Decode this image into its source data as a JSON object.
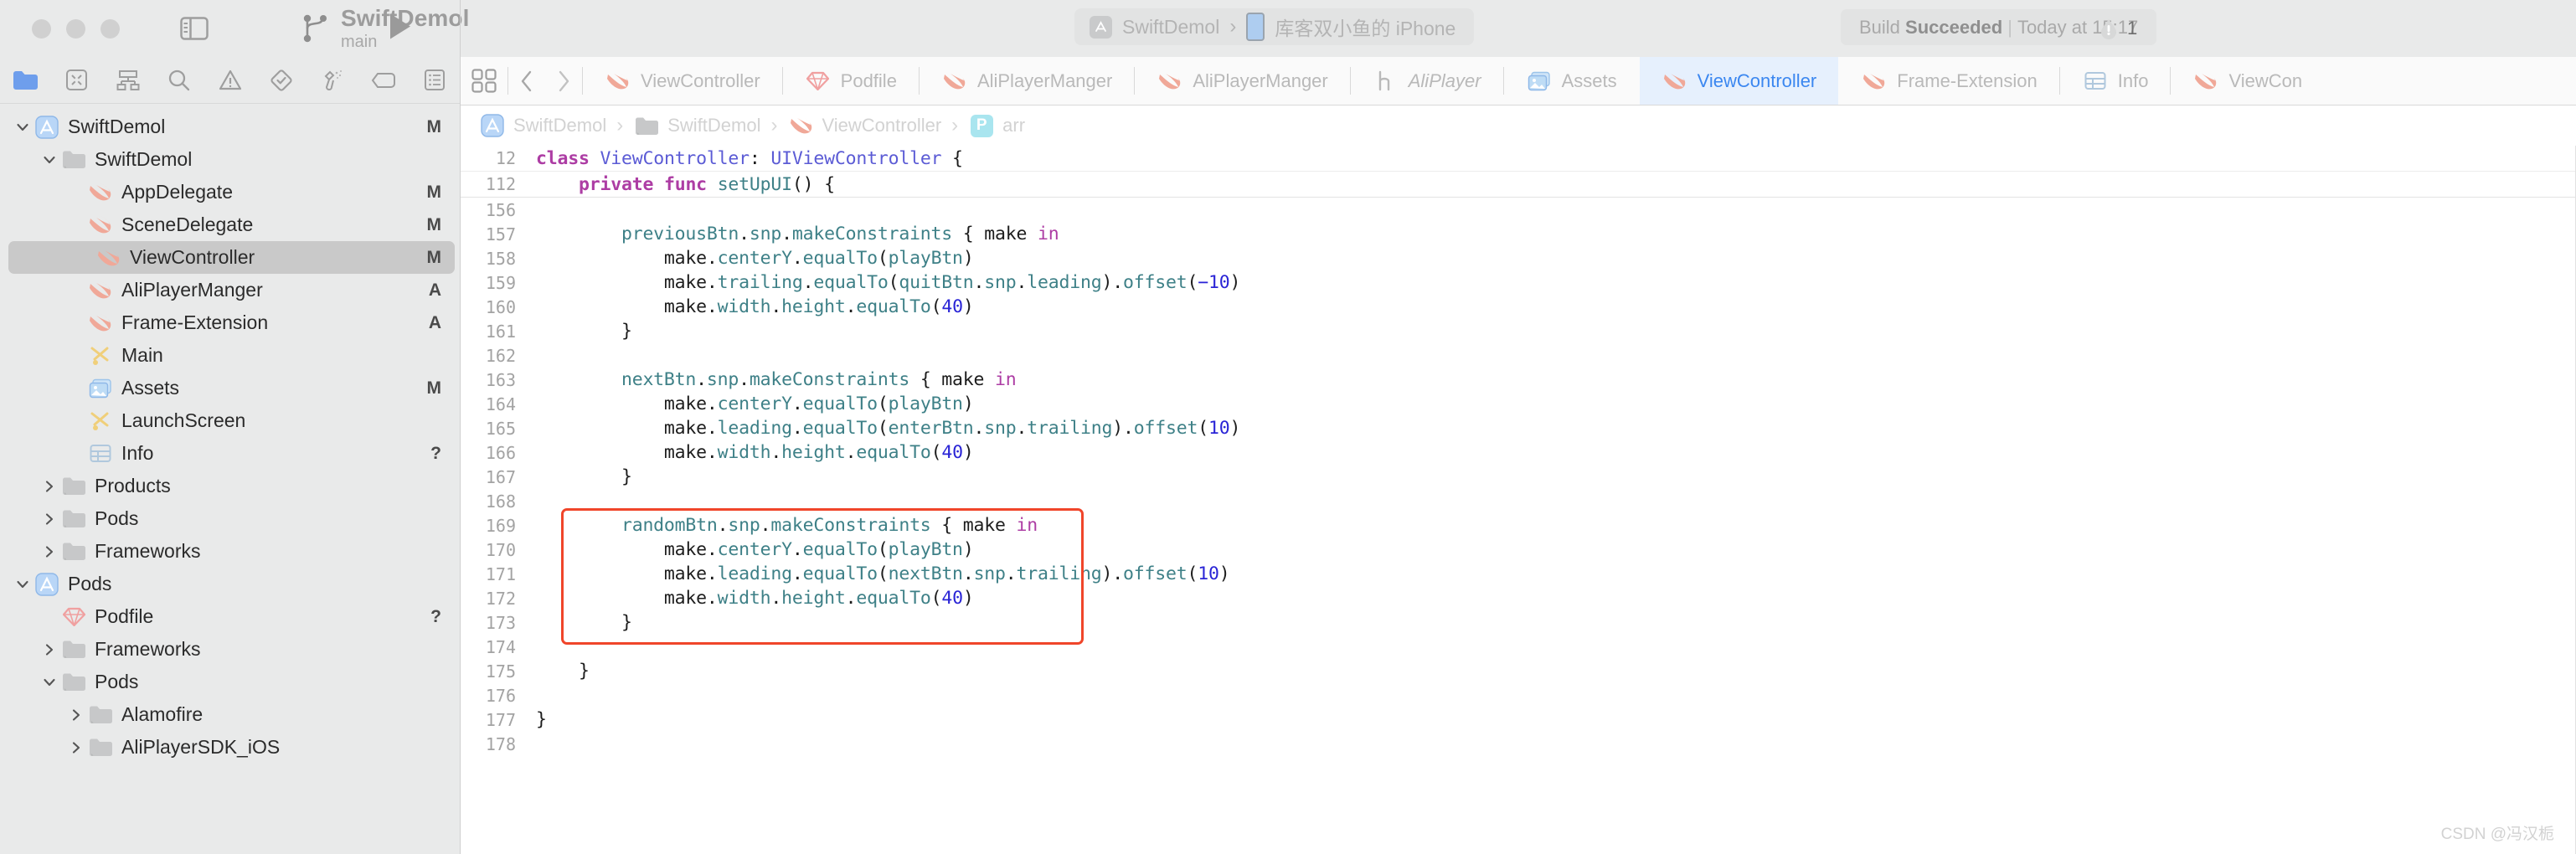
{
  "toolbar": {
    "window_buttons": [
      "close",
      "minimize",
      "zoom"
    ],
    "sidebar_toggle": "toggle-navigator",
    "run_button": "run",
    "project_name": "SwiftDemol",
    "branch_name": "main",
    "scheme_name": "SwiftDemol",
    "scheme_separator": "›",
    "device_name": "库客双小鱼的 iPhone",
    "status_prefix": "Build ",
    "status_result": "Succeeded",
    "status_divider": "|",
    "status_time": "Today at 15:17",
    "warning_count": "1"
  },
  "navigator": {
    "icons": [
      "folder-icon",
      "source-control-icon",
      "hierarchy-icon",
      "search-icon",
      "warning-icon",
      "test-icon",
      "debug-icon",
      "breakpoint-icon",
      "report-icon"
    ],
    "tree": [
      {
        "label": "SwiftDemol",
        "indent": 0,
        "icon": "app-project-icon",
        "twisty": "down",
        "badge": "M",
        "selected": false
      },
      {
        "label": "SwiftDemol",
        "indent": 1,
        "icon": "folder-icon",
        "twisty": "down",
        "badge": "",
        "selected": false
      },
      {
        "label": "AppDelegate",
        "indent": 2,
        "icon": "swift-icon",
        "twisty": "",
        "badge": "M",
        "selected": false
      },
      {
        "label": "SceneDelegate",
        "indent": 2,
        "icon": "swift-icon",
        "twisty": "",
        "badge": "M",
        "selected": false
      },
      {
        "label": "ViewController",
        "indent": 2,
        "icon": "swift-icon",
        "twisty": "",
        "badge": "M",
        "selected": true
      },
      {
        "label": "AliPlayerManger",
        "indent": 2,
        "icon": "swift-icon",
        "twisty": "",
        "badge": "A",
        "selected": false
      },
      {
        "label": "Frame-Extension",
        "indent": 2,
        "icon": "swift-icon",
        "twisty": "",
        "badge": "A",
        "selected": false
      },
      {
        "label": "Main",
        "indent": 2,
        "icon": "storyboard-icon",
        "twisty": "",
        "badge": "",
        "selected": false
      },
      {
        "label": "Assets",
        "indent": 2,
        "icon": "assets-icon",
        "twisty": "",
        "badge": "M",
        "selected": false
      },
      {
        "label": "LaunchScreen",
        "indent": 2,
        "icon": "storyboard-icon",
        "twisty": "",
        "badge": "",
        "selected": false
      },
      {
        "label": "Info",
        "indent": 2,
        "icon": "plist-icon",
        "twisty": "",
        "badge": "?",
        "selected": false
      },
      {
        "label": "Products",
        "indent": 1,
        "icon": "folder-icon",
        "twisty": "right",
        "badge": "",
        "selected": false
      },
      {
        "label": "Pods",
        "indent": 1,
        "icon": "folder-icon",
        "twisty": "right",
        "badge": "",
        "selected": false
      },
      {
        "label": "Frameworks",
        "indent": 1,
        "icon": "folder-icon",
        "twisty": "right",
        "badge": "",
        "selected": false
      },
      {
        "label": "Pods",
        "indent": 0,
        "icon": "app-project-icon",
        "twisty": "down",
        "badge": "",
        "selected": false
      },
      {
        "label": "Podfile",
        "indent": 1,
        "icon": "ruby-icon",
        "twisty": "",
        "badge": "?",
        "selected": false
      },
      {
        "label": "Frameworks",
        "indent": 1,
        "icon": "folder-icon",
        "twisty": "right",
        "badge": "",
        "selected": false
      },
      {
        "label": "Pods",
        "indent": 1,
        "icon": "folder-icon",
        "twisty": "down",
        "badge": "",
        "selected": false
      },
      {
        "label": "Alamofire",
        "indent": 2,
        "icon": "folder-icon",
        "twisty": "right",
        "badge": "",
        "selected": false
      },
      {
        "label": "AliPlayerSDK_iOS",
        "indent": 2,
        "icon": "folder-icon",
        "twisty": "right",
        "badge": "",
        "selected": false
      }
    ]
  },
  "editor": {
    "toolbar_icons": [
      "editor-layout-icon",
      "back-arrow-icon",
      "forward-arrow-icon"
    ],
    "tabs": [
      {
        "label": "ViewController",
        "icon": "swift-icon",
        "active": false,
        "italic": false
      },
      {
        "label": "Podfile",
        "icon": "ruby-icon",
        "active": false,
        "italic": false
      },
      {
        "label": "AliPlayerManger",
        "icon": "swift-icon",
        "active": false,
        "italic": false
      },
      {
        "label": "AliPlayerManger",
        "icon": "swift-icon",
        "active": false,
        "italic": false
      },
      {
        "label": "AliPlayer",
        "icon": "header-icon",
        "active": false,
        "italic": true
      },
      {
        "label": "Assets",
        "icon": "assets-icon",
        "active": false,
        "italic": false
      },
      {
        "label": "ViewController",
        "icon": "swift-icon",
        "active": true,
        "italic": false
      },
      {
        "label": "Frame-Extension",
        "icon": "swift-icon",
        "active": false,
        "italic": false
      },
      {
        "label": "Info",
        "icon": "plist-icon",
        "active": false,
        "italic": false
      },
      {
        "label": "ViewCon",
        "icon": "swift-icon",
        "active": false,
        "italic": false
      }
    ],
    "breadcrumb": [
      {
        "label": "SwiftDemol",
        "icon": "app-project-icon"
      },
      {
        "label": "SwiftDemol",
        "icon": "folder-icon"
      },
      {
        "label": "ViewController",
        "icon": "swift-icon"
      },
      {
        "label": "arr",
        "icon": "property-badge",
        "badge_letter": "P"
      }
    ],
    "breadcrumb_separator": "›",
    "pinned_lines": [
      {
        "num": "12",
        "tokens": [
          {
            "t": "class",
            "c": "kw"
          },
          {
            "t": " ",
            "c": "plain"
          },
          {
            "t": "ViewController",
            "c": "type"
          },
          {
            "t": ": ",
            "c": "plain"
          },
          {
            "t": "UIViewController",
            "c": "type"
          },
          {
            "t": " {",
            "c": "plain"
          }
        ]
      },
      {
        "num": "112",
        "tokens": [
          {
            "t": "    ",
            "c": "plain"
          },
          {
            "t": "private",
            "c": "kw"
          },
          {
            "t": " ",
            "c": "plain"
          },
          {
            "t": "func",
            "c": "kw"
          },
          {
            "t": " ",
            "c": "plain"
          },
          {
            "t": "setUpUI",
            "c": "mth"
          },
          {
            "t": "() {",
            "c": "plain"
          }
        ]
      }
    ],
    "lines": [
      {
        "num": "156",
        "tokens": []
      },
      {
        "num": "157",
        "tokens": [
          {
            "t": "        ",
            "c": "plain"
          },
          {
            "t": "previousBtn",
            "c": "typec"
          },
          {
            "t": ".",
            "c": "plain"
          },
          {
            "t": "snp",
            "c": "typec"
          },
          {
            "t": ".",
            "c": "plain"
          },
          {
            "t": "makeConstraints",
            "c": "typec"
          },
          {
            "t": " { make ",
            "c": "plain"
          },
          {
            "t": "in",
            "c": "kw2"
          }
        ]
      },
      {
        "num": "158",
        "tokens": [
          {
            "t": "            make.",
            "c": "plain"
          },
          {
            "t": "centerY",
            "c": "typec"
          },
          {
            "t": ".",
            "c": "plain"
          },
          {
            "t": "equalTo",
            "c": "typec"
          },
          {
            "t": "(",
            "c": "plain"
          },
          {
            "t": "playBtn",
            "c": "typec"
          },
          {
            "t": ")",
            "c": "plain"
          }
        ]
      },
      {
        "num": "159",
        "tokens": [
          {
            "t": "            make.",
            "c": "plain"
          },
          {
            "t": "trailing",
            "c": "typec"
          },
          {
            "t": ".",
            "c": "plain"
          },
          {
            "t": "equalTo",
            "c": "typec"
          },
          {
            "t": "(",
            "c": "plain"
          },
          {
            "t": "quitBtn",
            "c": "typec"
          },
          {
            "t": ".",
            "c": "plain"
          },
          {
            "t": "snp",
            "c": "typec"
          },
          {
            "t": ".",
            "c": "plain"
          },
          {
            "t": "leading",
            "c": "typec"
          },
          {
            "t": ").",
            "c": "plain"
          },
          {
            "t": "offset",
            "c": "typec"
          },
          {
            "t": "(",
            "c": "plain"
          },
          {
            "t": "−10",
            "c": "num"
          },
          {
            "t": ")",
            "c": "plain"
          }
        ]
      },
      {
        "num": "160",
        "tokens": [
          {
            "t": "            make.",
            "c": "plain"
          },
          {
            "t": "width",
            "c": "typec"
          },
          {
            "t": ".",
            "c": "plain"
          },
          {
            "t": "height",
            "c": "typec"
          },
          {
            "t": ".",
            "c": "plain"
          },
          {
            "t": "equalTo",
            "c": "typec"
          },
          {
            "t": "(",
            "c": "plain"
          },
          {
            "t": "40",
            "c": "num"
          },
          {
            "t": ")",
            "c": "plain"
          }
        ]
      },
      {
        "num": "161",
        "tokens": [
          {
            "t": "        }",
            "c": "plain"
          }
        ]
      },
      {
        "num": "162",
        "tokens": []
      },
      {
        "num": "163",
        "tokens": [
          {
            "t": "        ",
            "c": "plain"
          },
          {
            "t": "nextBtn",
            "c": "typec"
          },
          {
            "t": ".",
            "c": "plain"
          },
          {
            "t": "snp",
            "c": "typec"
          },
          {
            "t": ".",
            "c": "plain"
          },
          {
            "t": "makeConstraints",
            "c": "typec"
          },
          {
            "t": " { make ",
            "c": "plain"
          },
          {
            "t": "in",
            "c": "kw2"
          }
        ]
      },
      {
        "num": "164",
        "tokens": [
          {
            "t": "            make.",
            "c": "plain"
          },
          {
            "t": "centerY",
            "c": "typec"
          },
          {
            "t": ".",
            "c": "plain"
          },
          {
            "t": "equalTo",
            "c": "typec"
          },
          {
            "t": "(",
            "c": "plain"
          },
          {
            "t": "playBtn",
            "c": "typec"
          },
          {
            "t": ")",
            "c": "plain"
          }
        ]
      },
      {
        "num": "165",
        "tokens": [
          {
            "t": "            make.",
            "c": "plain"
          },
          {
            "t": "leading",
            "c": "typec"
          },
          {
            "t": ".",
            "c": "plain"
          },
          {
            "t": "equalTo",
            "c": "typec"
          },
          {
            "t": "(",
            "c": "plain"
          },
          {
            "t": "enterBtn",
            "c": "typec"
          },
          {
            "t": ".",
            "c": "plain"
          },
          {
            "t": "snp",
            "c": "typec"
          },
          {
            "t": ".",
            "c": "plain"
          },
          {
            "t": "trailing",
            "c": "typec"
          },
          {
            "t": ").",
            "c": "plain"
          },
          {
            "t": "offset",
            "c": "typec"
          },
          {
            "t": "(",
            "c": "plain"
          },
          {
            "t": "10",
            "c": "num"
          },
          {
            "t": ")",
            "c": "plain"
          }
        ]
      },
      {
        "num": "166",
        "tokens": [
          {
            "t": "            make.",
            "c": "plain"
          },
          {
            "t": "width",
            "c": "typec"
          },
          {
            "t": ".",
            "c": "plain"
          },
          {
            "t": "height",
            "c": "typec"
          },
          {
            "t": ".",
            "c": "plain"
          },
          {
            "t": "equalTo",
            "c": "typec"
          },
          {
            "t": "(",
            "c": "plain"
          },
          {
            "t": "40",
            "c": "num"
          },
          {
            "t": ")",
            "c": "plain"
          }
        ]
      },
      {
        "num": "167",
        "tokens": [
          {
            "t": "        }",
            "c": "plain"
          }
        ]
      },
      {
        "num": "168",
        "tokens": []
      },
      {
        "num": "169",
        "tokens": [
          {
            "t": "        ",
            "c": "plain"
          },
          {
            "t": "randomBtn",
            "c": "typec"
          },
          {
            "t": ".",
            "c": "plain"
          },
          {
            "t": "snp",
            "c": "typec"
          },
          {
            "t": ".",
            "c": "plain"
          },
          {
            "t": "makeConstraints",
            "c": "typec"
          },
          {
            "t": " { make ",
            "c": "plain"
          },
          {
            "t": "in",
            "c": "kw2"
          }
        ]
      },
      {
        "num": "170",
        "tokens": [
          {
            "t": "            make.",
            "c": "plain"
          },
          {
            "t": "centerY",
            "c": "typec"
          },
          {
            "t": ".",
            "c": "plain"
          },
          {
            "t": "equalTo",
            "c": "typec"
          },
          {
            "t": "(",
            "c": "plain"
          },
          {
            "t": "playBtn",
            "c": "typec"
          },
          {
            "t": ")",
            "c": "plain"
          }
        ]
      },
      {
        "num": "171",
        "tokens": [
          {
            "t": "            make.",
            "c": "plain"
          },
          {
            "t": "leading",
            "c": "typec"
          },
          {
            "t": ".",
            "c": "plain"
          },
          {
            "t": "equalTo",
            "c": "typec"
          },
          {
            "t": "(",
            "c": "plain"
          },
          {
            "t": "nextBtn",
            "c": "typec"
          },
          {
            "t": ".",
            "c": "plain"
          },
          {
            "t": "snp",
            "c": "typec"
          },
          {
            "t": ".",
            "c": "plain"
          },
          {
            "t": "trailing",
            "c": "typec"
          },
          {
            "t": ").",
            "c": "plain"
          },
          {
            "t": "offset",
            "c": "typec"
          },
          {
            "t": "(",
            "c": "plain"
          },
          {
            "t": "10",
            "c": "num"
          },
          {
            "t": ")",
            "c": "plain"
          }
        ]
      },
      {
        "num": "172",
        "tokens": [
          {
            "t": "            make.",
            "c": "plain"
          },
          {
            "t": "width",
            "c": "typec"
          },
          {
            "t": ".",
            "c": "plain"
          },
          {
            "t": "height",
            "c": "typec"
          },
          {
            "t": ".",
            "c": "plain"
          },
          {
            "t": "equalTo",
            "c": "typec"
          },
          {
            "t": "(",
            "c": "plain"
          },
          {
            "t": "40",
            "c": "num"
          },
          {
            "t": ")",
            "c": "plain"
          }
        ]
      },
      {
        "num": "173",
        "tokens": [
          {
            "t": "        }",
            "c": "plain"
          }
        ]
      },
      {
        "num": "174",
        "tokens": []
      },
      {
        "num": "175",
        "tokens": [
          {
            "t": "    }",
            "c": "plain"
          }
        ]
      },
      {
        "num": "176",
        "tokens": []
      },
      {
        "num": "177",
        "tokens": [
          {
            "t": "}",
            "c": "plain"
          }
        ]
      },
      {
        "num": "178",
        "tokens": []
      }
    ],
    "highlight_box": {
      "start_line": "169",
      "end_line": "173",
      "color": "#f0452a"
    }
  },
  "watermark": "CSDN @冯汉栀",
  "colors": {
    "accent_blue": "#3b87f0",
    "active_tab_bg": "#e6f0fd",
    "highlight_red": "#f0452a",
    "chrome_gray": "#e9eaea",
    "swift_orange": "#f0a898"
  }
}
